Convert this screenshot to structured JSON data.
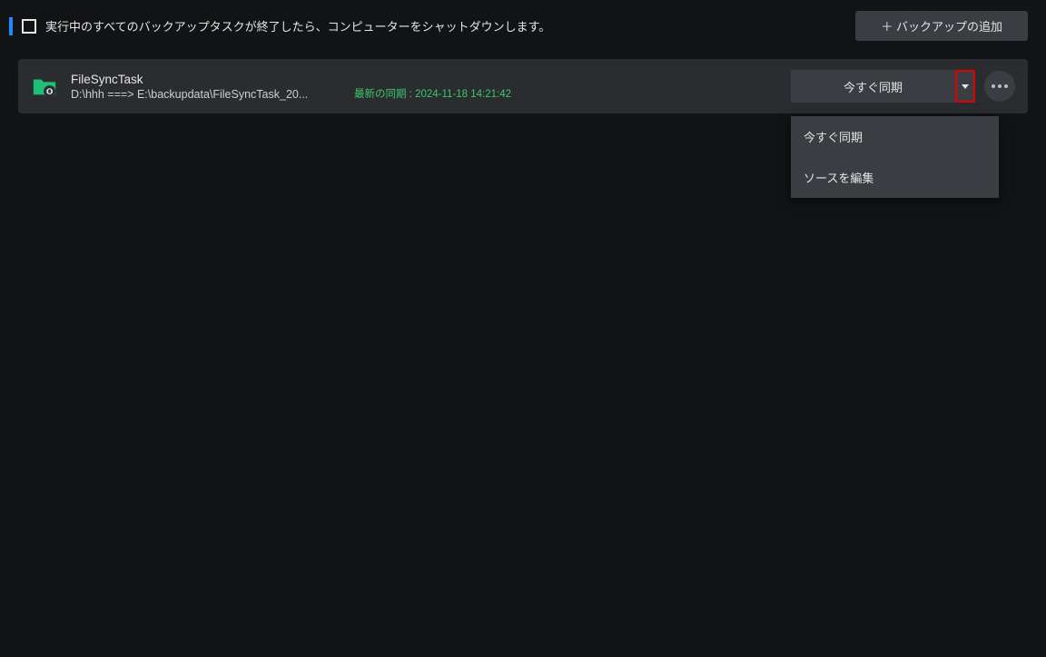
{
  "topbar": {
    "shutdown_label": "実行中のすべてのバックアップタスクが終了したら、コンピューターをシャットダウンします。",
    "add_backup": "＋ バックアップの追加"
  },
  "task": {
    "name": "FileSyncTask",
    "path": "D:\\hhh ===> E:\\backupdata\\FileSyncTask_20...",
    "last_sync_prefix": "最新の同期 : ",
    "last_sync_time": "2024-11-18 14:21:42",
    "sync_now": "今すぐ同期"
  },
  "dropdown": {
    "sync_now": "今すぐ同期",
    "edit_source": "ソースを編集"
  },
  "colors": {
    "accent_blue": "#1a8cff",
    "success_green": "#3cc76a",
    "highlight_red": "#e00000",
    "bg": "#111315",
    "card": "#2a2c30",
    "button": "#3a3d41"
  },
  "icons": {
    "folder_sync": "folder-sync-icon",
    "more": "more-icon",
    "caret": "caret-down-icon"
  }
}
